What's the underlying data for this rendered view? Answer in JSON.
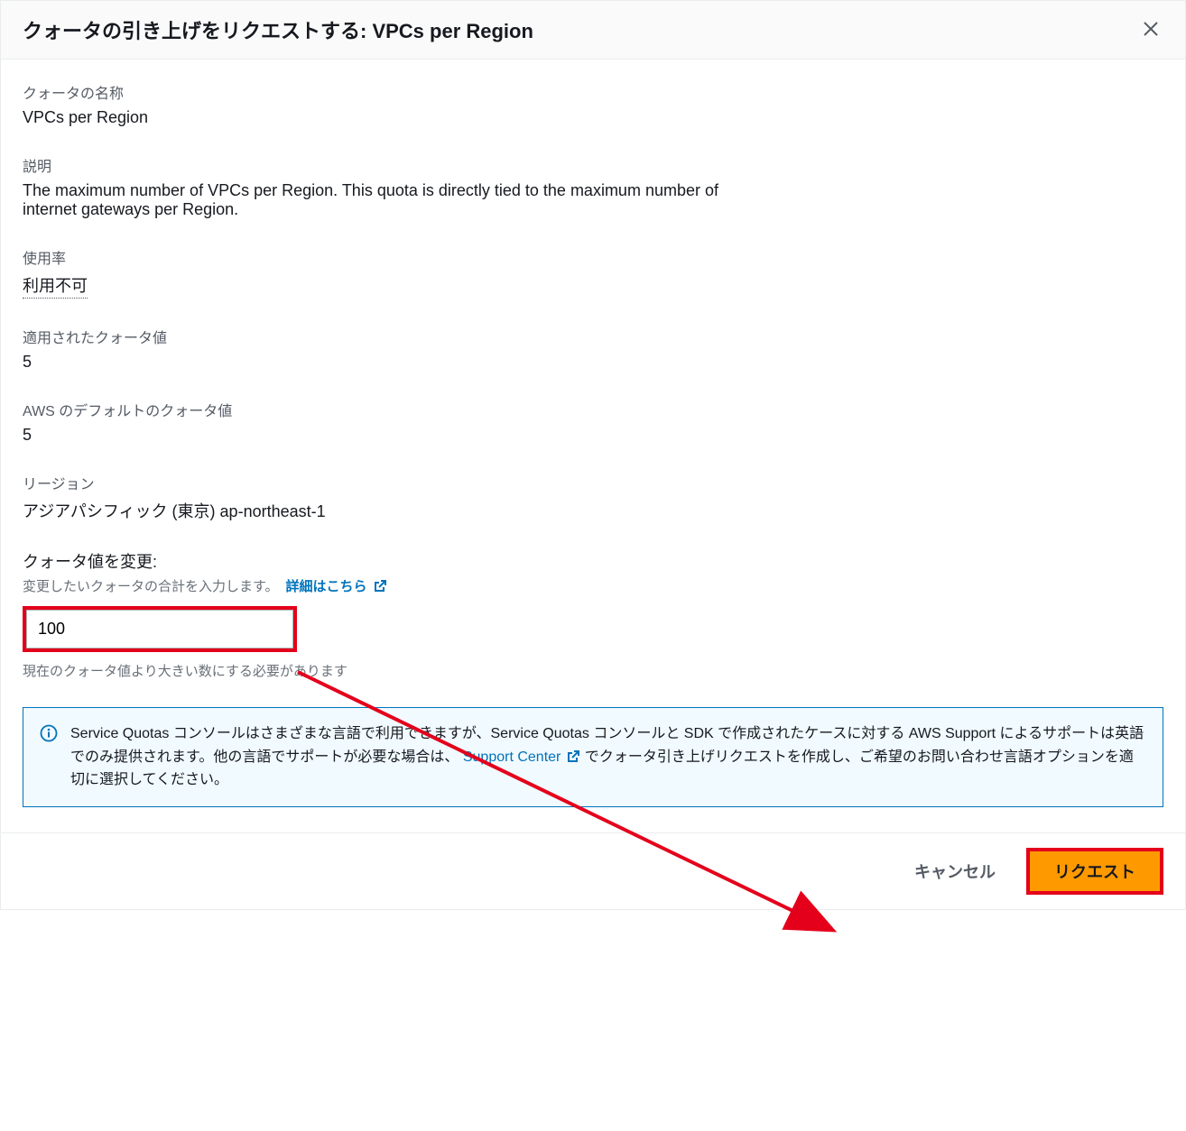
{
  "header": {
    "title": "クォータの引き上げをリクエストする: VPCs per Region"
  },
  "fields": {
    "name_label": "クォータの名称",
    "name_value": "VPCs per Region",
    "description_label": "説明",
    "description_value": "The maximum number of VPCs per Region. This quota is directly tied to the maximum number of internet gateways per Region.",
    "usage_label": "使用率",
    "usage_value": "利用不可",
    "applied_label": "適用されたクォータ値",
    "applied_value": "5",
    "default_label": "AWS のデフォルトのクォータ値",
    "default_value": "5",
    "region_label": "リージョン",
    "region_value": "アジアパシフィック (東京) ap-northeast-1"
  },
  "change": {
    "title": "クォータ値を変更:",
    "help": "変更したいクォータの合計を入力します。",
    "learn_more": "詳細はこちら",
    "input_value": "100",
    "constraint": "現在のクォータ値より大きい数にする必要があります"
  },
  "info": {
    "text_before": "Service Quotas コンソールはさまざまな言語で利用できますが、Service Quotas コンソールと SDK で作成されたケースに対する AWS Support によるサポートは英語でのみ提供されます。他の言語でサポートが必要な場合は、",
    "support_link": "Support Center",
    "text_after": " でクォータ引き上げリクエストを作成し、ご希望のお問い合わせ言語オプションを適切に選択してください。"
  },
  "footer": {
    "cancel": "キャンセル",
    "submit": "リクエスト"
  }
}
